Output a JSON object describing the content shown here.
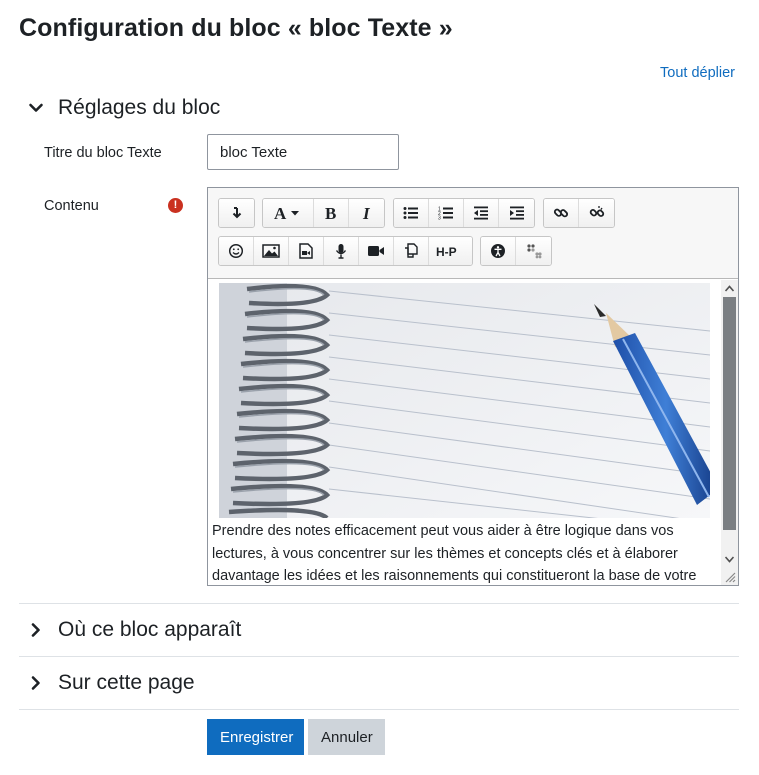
{
  "page": {
    "title": "Configuration du bloc « bloc Texte »",
    "expand_all": "Tout déplier"
  },
  "sections": {
    "block_settings": {
      "label": "Réglages du bloc",
      "state": "expanded"
    },
    "where_appears": {
      "label": "Où ce bloc apparaît",
      "state": "collapsed"
    },
    "on_this_page": {
      "label": "Sur cette page",
      "state": "collapsed"
    }
  },
  "form": {
    "title_label": "Titre du bloc Texte",
    "title_value": "bloc Texte",
    "content_label": "Contenu",
    "required_icon": "exclamation-circle-icon",
    "required_glyph": "!",
    "required_color": "#ca3120"
  },
  "toolbar": {
    "row1": [
      [
        "collapse-icon"
      ],
      [
        "font-color-icon",
        "bold-icon",
        "italic-icon"
      ],
      [
        "unordered-list-icon",
        "ordered-list-icon",
        "outdent-icon",
        "indent-icon"
      ],
      [
        "link-icon",
        "unlink-icon"
      ]
    ],
    "row2": [
      [
        "emoji-icon",
        "image-icon",
        "media-icon",
        "record-audio-icon",
        "record-video-icon",
        "manage-files-icon",
        "h5p-icon"
      ],
      [
        "accessibility-checker-icon",
        "screenreader-helper-icon"
      ]
    ],
    "h5p_label": "H-P"
  },
  "editor": {
    "image_icon": "notebook-and-pencil-photo",
    "text": "Prendre des notes efficacement peut vous aider à être logique dans vos lectures, à vous concentrer sur les thèmes et concepts clés et à élaborer davantage les idées et les raisonnements qui constitueront la base de votre"
  },
  "buttons": {
    "save": "Enregistrer",
    "cancel": "Annuler"
  },
  "colors": {
    "primary": "#0f6cbf",
    "secondary": "#ced4da",
    "text": "#1d2125",
    "link": "#0f6cbf"
  }
}
